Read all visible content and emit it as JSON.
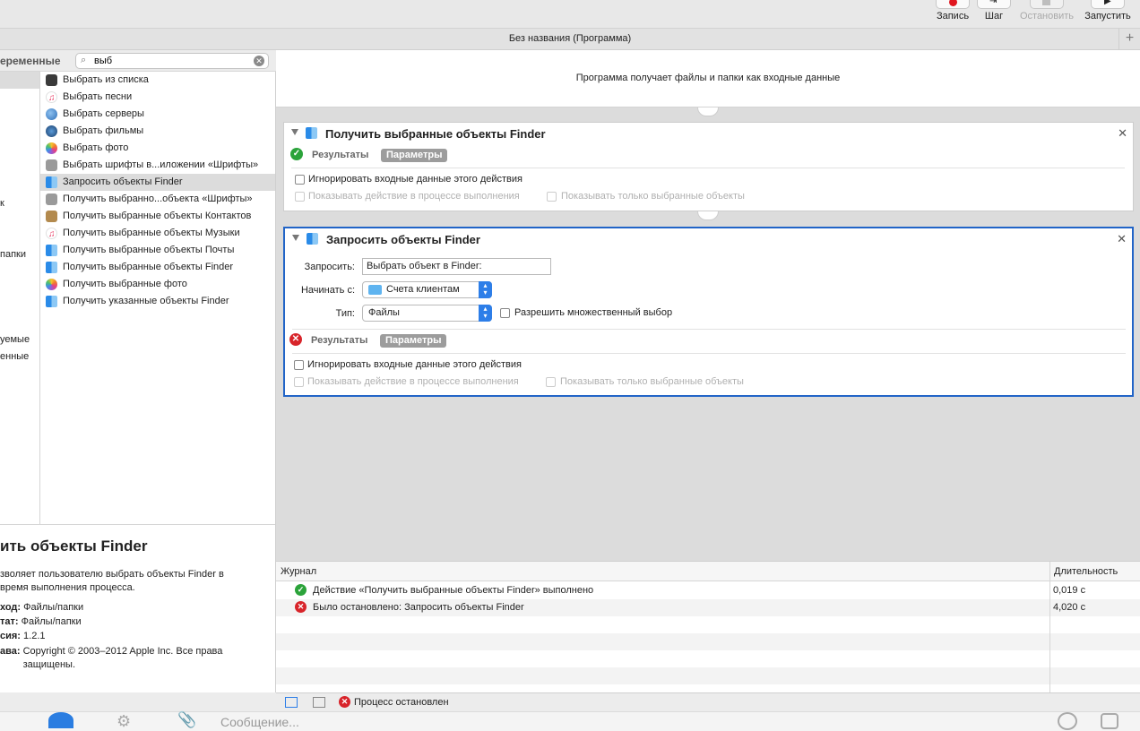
{
  "toolbar": {
    "record": "Запись",
    "step": "Шаг",
    "stop": "Остановить",
    "run": "Запустить"
  },
  "window_title": "Без названия (Программа)",
  "sidebar": {
    "header_partial": "еременные",
    "search_value": "выб",
    "library_partials": [
      "к",
      "папки",
      "уемые",
      "енные"
    ],
    "actions": [
      {
        "label": "Выбрать из списка",
        "icon": "list-icon"
      },
      {
        "label": "Выбрать песни",
        "icon": "music-icon"
      },
      {
        "label": "Выбрать серверы",
        "icon": "globe-icon"
      },
      {
        "label": "Выбрать фильмы",
        "icon": "quicktime-icon"
      },
      {
        "label": "Выбрать фото",
        "icon": "photos-icon"
      },
      {
        "label": "Выбрать шрифты в...иложении «Шрифты»",
        "icon": "font-book-icon"
      },
      {
        "label": "Запросить объекты Finder",
        "icon": "finder-icon",
        "selected": true
      },
      {
        "label": "Получить выбранно...объекта «Шрифты»",
        "icon": "font-book-icon"
      },
      {
        "label": "Получить выбранные объекты Контактов",
        "icon": "contacts-icon"
      },
      {
        "label": "Получить выбранные объекты Музыки",
        "icon": "music-icon"
      },
      {
        "label": "Получить выбранные объекты Почты",
        "icon": "finder-icon"
      },
      {
        "label": "Получить выбранные объекты Finder",
        "icon": "finder-icon"
      },
      {
        "label": "Получить выбранные фото",
        "icon": "photos-icon"
      },
      {
        "label": "Получить указанные объекты Finder",
        "icon": "finder-icon"
      }
    ]
  },
  "description": {
    "title": "ить объекты Finder",
    "text": "зволяет пользователю выбрать объекты Finder в\n время выполнения процесса.",
    "rows": [
      {
        "key": "ход:",
        "value": "Файлы/папки"
      },
      {
        "key": "тат:",
        "value": "Файлы/папки"
      },
      {
        "key": "сия:",
        "value": "1.2.1"
      },
      {
        "key": "ава:",
        "value": "Copyright © 2003–2012 Apple Inc. Все права\nзащищены."
      }
    ]
  },
  "workflow": {
    "input_text": "Программа получает файлы и папки как входные данные",
    "cards": [
      {
        "title": "Получить выбранные объекты Finder",
        "results": "Результаты",
        "params": "Параметры",
        "ignore_input": "Игнорировать входные данные этого действия",
        "show_action": "Показывать действие в процессе выполнения",
        "show_selected": "Показывать только выбранные объекты"
      },
      {
        "title": "Запросить объекты Finder",
        "prompt_label": "Запросить:",
        "prompt_value": "Выбрать объект в Finder:",
        "start_label": "Начинать с:",
        "start_value": "Счета клиентам",
        "type_label": "Тип:",
        "type_value": "Файлы",
        "multi_select": "Разрешить множественный выбор",
        "results": "Результаты",
        "params": "Параметры",
        "ignore_input": "Игнорировать входные данные этого действия",
        "show_action": "Показывать действие в процессе выполнения",
        "show_selected": "Показывать только выбранные объекты"
      }
    ]
  },
  "log": {
    "col_journal": "Журнал",
    "col_duration": "Длительность",
    "rows": [
      {
        "status": "ok",
        "text": "Действие «Получить выбранные объекты Finder» выполнено",
        "duration": "0,019 с"
      },
      {
        "status": "error",
        "text": "Было остановлено: Запросить объекты Finder",
        "duration": "4,020 с"
      }
    ]
  },
  "status": {
    "text": "Процесс остановлен"
  },
  "message_bar": {
    "placeholder": "Сообщение..."
  },
  "colors": {
    "accent": "#2264c7",
    "ok": "#2ba33a",
    "error": "#d8242a"
  }
}
